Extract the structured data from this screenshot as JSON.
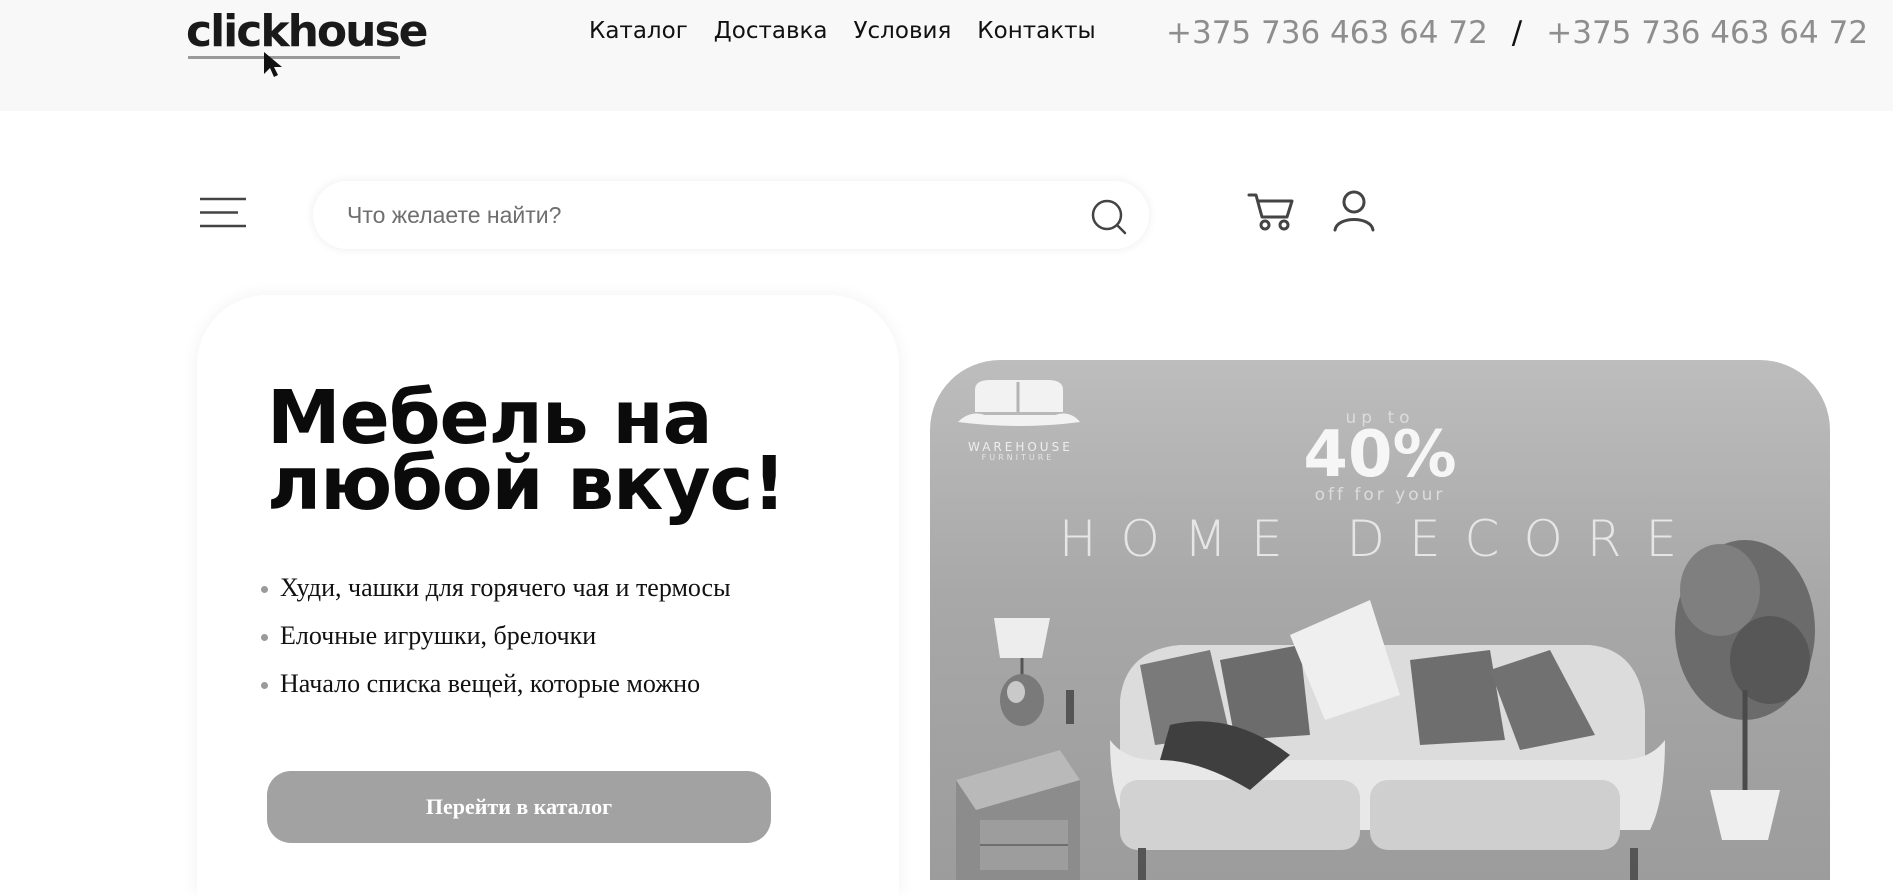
{
  "header": {
    "logo_text": "clickhouse",
    "nav": [
      "Каталог",
      "Доставка",
      "Условия",
      "Контакты"
    ],
    "phones": [
      "+375 736 463 64 72",
      "+375 736 463 64 72"
    ],
    "phone_separator": "/"
  },
  "toolbar": {
    "menu_icon": "hamburger-icon",
    "search_placeholder": "Что желаете найти?",
    "search_icon": "search-icon",
    "cart_icon": "cart-icon",
    "user_icon": "user-icon"
  },
  "hero": {
    "title_line1": "Мебель на",
    "title_line2": "любой вкус!",
    "items": [
      "Худи, чашки для горячего чая и термосы",
      "Елочные игрушки, брелочки",
      "Начало списка вещей, которые можно"
    ],
    "cta_label": "Перейти в каталог"
  },
  "banner": {
    "brand": "WAREHOUSE",
    "brand_sub": "FURNITURE",
    "up_to": "up to",
    "discount": "40%",
    "off_for": "off for your",
    "headline": "HOME DECORE"
  },
  "colors": {
    "topbar_bg": "#f8f8f8",
    "cta_bg": "#a2a2a2",
    "phone_text": "#8e8e8e"
  }
}
